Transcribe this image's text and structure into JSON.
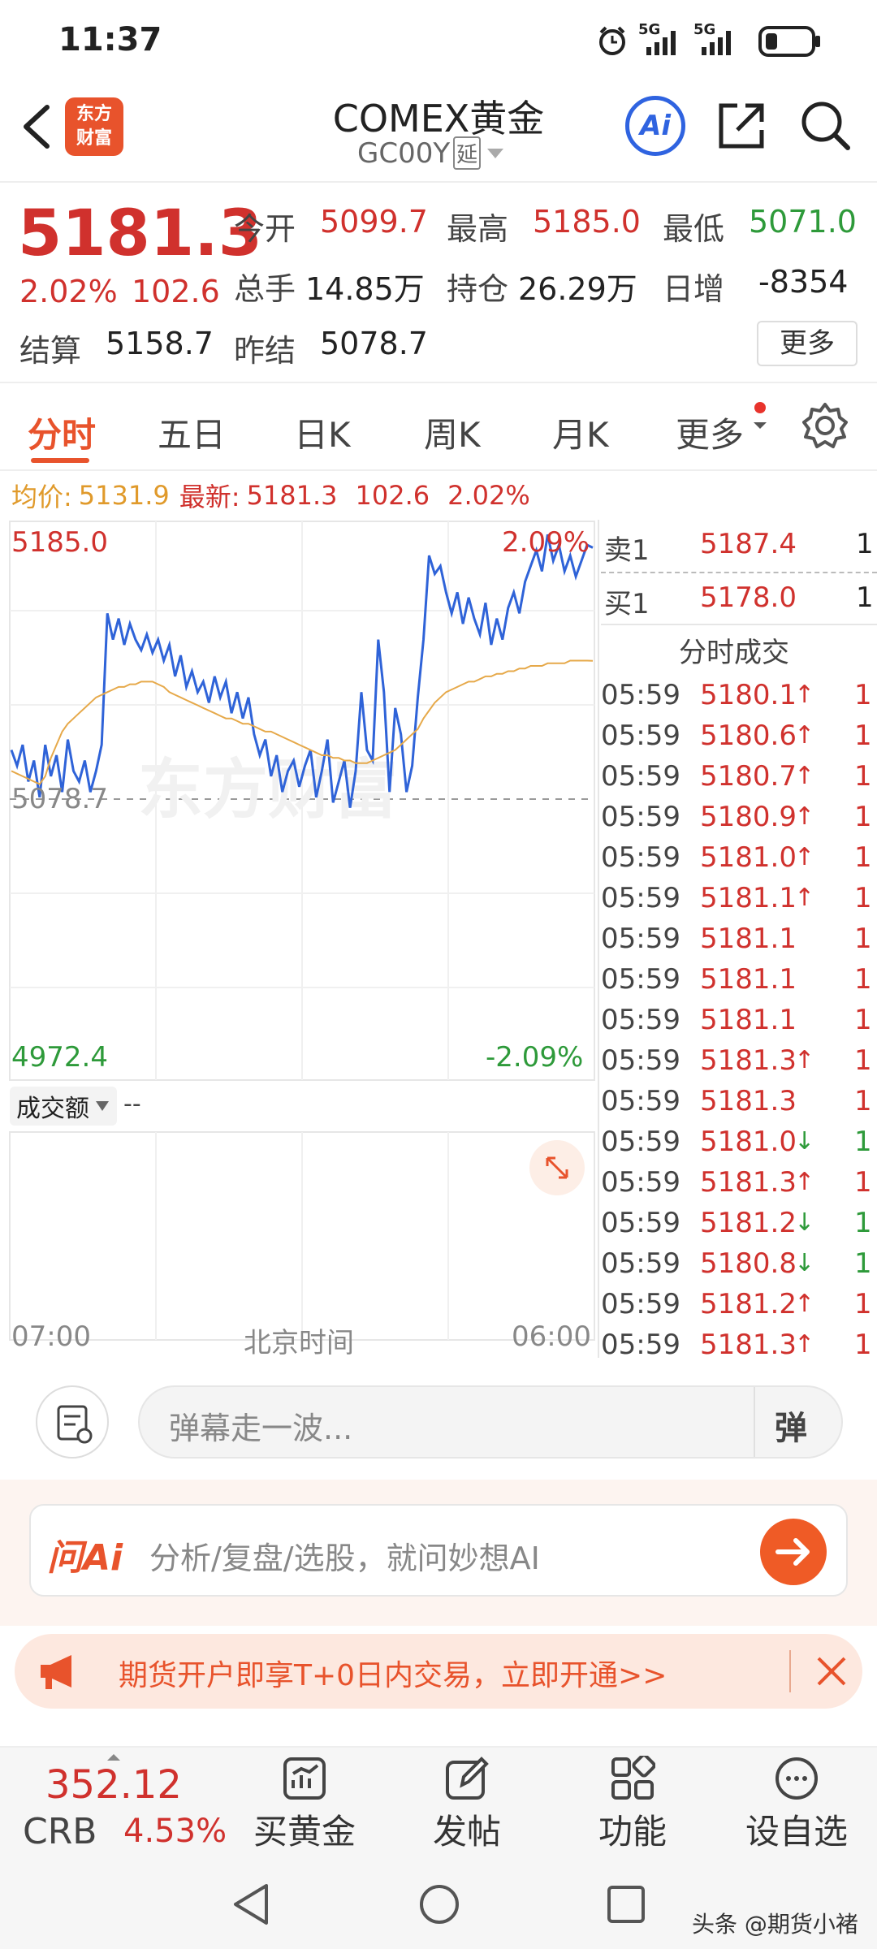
{
  "status_bar": {
    "time": "11:37",
    "signal_1": "5G",
    "signal_2": "5G"
  },
  "header": {
    "logo_line1": "东方",
    "logo_line2": "财富",
    "title": "COMEX黄金",
    "code": "GC00Y",
    "delay_badge": "延",
    "ai_label": "Ai"
  },
  "quote": {
    "price": "5181.3",
    "change_pct": "2.02%",
    "change": "102.6",
    "open_label": "今开",
    "open": "5099.7",
    "high_label": "最高",
    "high": "5185.0",
    "low_label": "最低",
    "low": "5071.0",
    "volume_label": "总手",
    "volume": "14.85万",
    "oi_label": "持仓",
    "oi": "26.29万",
    "daily_inc_label": "日增",
    "daily_inc": "-8354",
    "settle_label": "结算",
    "settle": "5158.7",
    "prev_settle_label": "昨结",
    "prev_settle": "5078.7",
    "more_button": "更多"
  },
  "tabs": [
    "分时",
    "五日",
    "日K",
    "周K",
    "月K",
    "更多"
  ],
  "info_line": {
    "avg_label": "均价:",
    "avg": "5131.9",
    "latest_label": "最新:",
    "latest": "5181.3",
    "change": "102.6",
    "pct": "2.02%"
  },
  "chart": {
    "top_price": "5185.0",
    "top_pct": "2.09%",
    "base_price": "5078.7",
    "bottom_price": "4972.4",
    "bottom_pct": "-2.09%",
    "volume_selector": "成交额",
    "volume_value": "--",
    "x_start": "07:00",
    "x_mid": "北京时间",
    "x_end": "06:00",
    "watermark": "东方财富"
  },
  "chart_data": {
    "type": "line",
    "ylim": [
      4972.4,
      5185.0
    ],
    "reference": 5078.7,
    "series": [
      {
        "name": "",
        "values": [
          5098,
          5092,
          5100,
          5086,
          5094,
          5080,
          5100,
          5088,
          5096,
          5082,
          5102,
          5090,
          5086,
          5094,
          5082,
          5090,
          5100,
          5150,
          5140,
          5148,
          5138,
          5146,
          5140,
          5136,
          5142,
          5135,
          5140,
          5132,
          5138,
          5126,
          5134,
          5122,
          5128,
          5120,
          5124,
          5116,
          5126,
          5118,
          5124,
          5112,
          5120,
          5110,
          5118,
          5104,
          5096,
          5102,
          5088,
          5096,
          5082,
          5090,
          5094,
          5084,
          5092,
          5098,
          5080,
          5090,
          5102,
          5078,
          5086,
          5094,
          5076,
          5090,
          5120,
          5098,
          5094,
          5140,
          5120,
          5082,
          5114,
          5104,
          5082,
          5092,
          5118,
          5140,
          5172,
          5165,
          5168,
          5158,
          5150,
          5158,
          5146,
          5156,
          5148,
          5142,
          5154,
          5138,
          5148,
          5140,
          5152,
          5158,
          5150,
          5162,
          5168,
          5174,
          5166,
          5180,
          5170,
          5176,
          5166,
          5172,
          5164,
          5170,
          5176,
          5175
        ]
      },
      {
        "name": "",
        "values": [
          5090,
          5089,
          5088,
          5087,
          5086,
          5085,
          5088,
          5095,
          5100,
          5105,
          5108,
          5110,
          5112,
          5114,
          5116,
          5118,
          5119,
          5120,
          5121,
          5122,
          5122,
          5123,
          5123,
          5124,
          5124,
          5124,
          5123,
          5122,
          5120,
          5119,
          5118,
          5117,
          5116,
          5115,
          5114,
          5113,
          5112,
          5111,
          5110,
          5110,
          5109,
          5108,
          5108,
          5107,
          5106,
          5105,
          5105,
          5104,
          5103,
          5102,
          5101,
          5100,
          5099,
          5098,
          5097,
          5096,
          5096,
          5095,
          5095,
          5094,
          5094,
          5093,
          5093,
          5093,
          5094,
          5095,
          5096,
          5097,
          5098,
          5100,
          5102,
          5104,
          5106,
          5110,
          5113,
          5116,
          5118,
          5120,
          5121,
          5122,
          5123,
          5124,
          5124,
          5125,
          5126,
          5126,
          5127,
          5127,
          5128,
          5128,
          5129,
          5129,
          5130,
          5130,
          5130,
          5131,
          5131,
          5131,
          5131,
          5132,
          5132,
          5132,
          5132,
          5131.9
        ]
      }
    ]
  },
  "orderbook": {
    "ask_label": "卖1",
    "ask_price": "5187.4",
    "ask_qty": "1",
    "bid_label": "买1",
    "bid_price": "5178.0",
    "bid_qty": "1",
    "trades_title": "分时成交"
  },
  "trades": [
    {
      "time": "05:59",
      "price": "5180.1",
      "arrow": "↑",
      "qty": "1",
      "dir": "up"
    },
    {
      "time": "05:59",
      "price": "5180.6",
      "arrow": "↑",
      "qty": "1",
      "dir": "up"
    },
    {
      "time": "05:59",
      "price": "5180.7",
      "arrow": "↑",
      "qty": "1",
      "dir": "up"
    },
    {
      "time": "05:59",
      "price": "5180.9",
      "arrow": "↑",
      "qty": "1",
      "dir": "up"
    },
    {
      "time": "05:59",
      "price": "5181.0",
      "arrow": "↑",
      "qty": "1",
      "dir": "up"
    },
    {
      "time": "05:59",
      "price": "5181.1",
      "arrow": "↑",
      "qty": "1",
      "dir": "up"
    },
    {
      "time": "05:59",
      "price": "5181.1",
      "arrow": "",
      "qty": "1",
      "dir": "flat"
    },
    {
      "time": "05:59",
      "price": "5181.1",
      "arrow": "",
      "qty": "1",
      "dir": "flat"
    },
    {
      "time": "05:59",
      "price": "5181.1",
      "arrow": "",
      "qty": "1",
      "dir": "flat"
    },
    {
      "time": "05:59",
      "price": "5181.3",
      "arrow": "↑",
      "qty": "1",
      "dir": "up"
    },
    {
      "time": "05:59",
      "price": "5181.3",
      "arrow": "",
      "qty": "1",
      "dir": "flat"
    },
    {
      "time": "05:59",
      "price": "5181.0",
      "arrow": "↓",
      "qty": "1",
      "dir": "down"
    },
    {
      "time": "05:59",
      "price": "5181.3",
      "arrow": "↑",
      "qty": "1",
      "dir": "up"
    },
    {
      "time": "05:59",
      "price": "5181.2",
      "arrow": "↓",
      "qty": "1",
      "dir": "down"
    },
    {
      "time": "05:59",
      "price": "5180.8",
      "arrow": "↓",
      "qty": "1",
      "dir": "down"
    },
    {
      "time": "05:59",
      "price": "5181.2",
      "arrow": "↑",
      "qty": "1",
      "dir": "up"
    },
    {
      "time": "05:59",
      "price": "5181.3",
      "arrow": "↑",
      "qty": "1",
      "dir": "up"
    }
  ],
  "comment_bar": {
    "placeholder": "弹幕走一波...",
    "danmaku_btn": "弹"
  },
  "ai_bar": {
    "logo": "问Ai",
    "placeholder": "分析/复盘/选股，就问妙想AI"
  },
  "promo": {
    "text": "期货开户即享T+0日内交易，立即开通>>"
  },
  "bottom_nav": {
    "index_value": "352.12",
    "index_name": "CRB",
    "index_pct": "4.53%",
    "items": [
      "买黄金",
      "发帖",
      "功能",
      "设自选"
    ]
  },
  "watermark_footer": "头条 @期货小褚"
}
